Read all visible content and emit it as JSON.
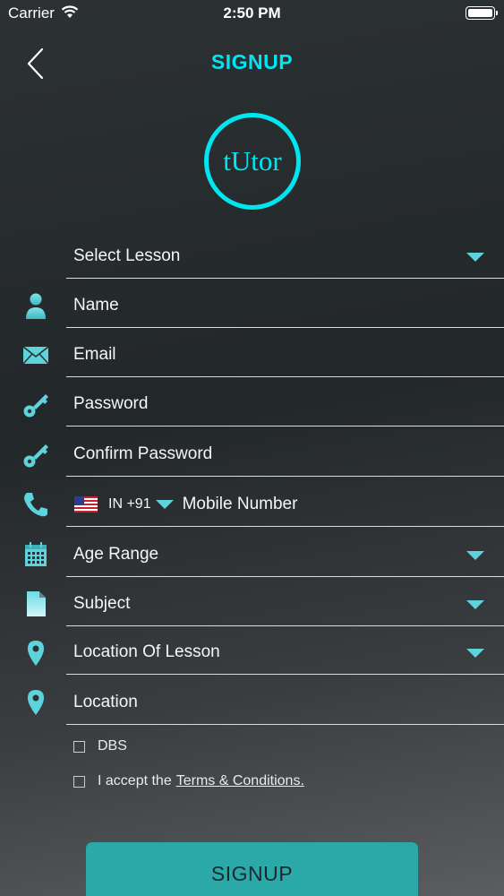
{
  "status_bar": {
    "carrier": "Carrier",
    "time": "2:50 PM"
  },
  "header": {
    "title": "SIGNUP"
  },
  "logo": {
    "text": "tUtor"
  },
  "form": {
    "select_lesson": "Select Lesson",
    "name": "Name",
    "email": "Email",
    "password": "Password",
    "confirm_password": "Confirm Password",
    "phone_code": "IN +91",
    "mobile_number": "Mobile Number",
    "age_range": "Age Range",
    "subject": "Subject",
    "location_of_lesson": "Location Of Lesson",
    "location": "Location"
  },
  "checks": {
    "dbs": "DBS",
    "accept_prefix": "I accept the",
    "terms_link": "Terms & Conditions."
  },
  "signup_button": "SIGNUP",
  "colors": {
    "accent": "#00e6f0",
    "icon": "#5ed3dc",
    "button": "#2aa9a8"
  }
}
